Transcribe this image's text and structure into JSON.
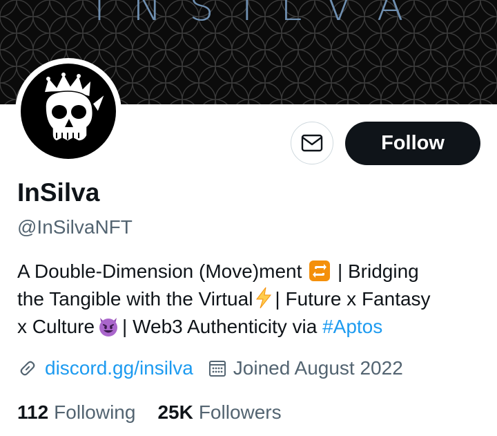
{
  "banner": {
    "title": "INSILVA"
  },
  "profile": {
    "display_name": "InSilva",
    "handle": "@InSilvaNFT"
  },
  "actions": {
    "message_icon": "envelope-icon",
    "follow_label": "Follow"
  },
  "bio": {
    "line1_pre": "A Double-Dimension (Move)ment",
    "line1_post": "| Bridging",
    "line2_pre": "the Tangible with the Virtual",
    "line2_post": "| Future x Fantasy",
    "line3_pre": "x Culture",
    "line3_post": "| Web3 Authenticity via",
    "hashtag": "#Aptos",
    "emojis": [
      "repeat-emoji",
      "lightning-emoji",
      "smiling-devil-emoji"
    ]
  },
  "meta": {
    "link_icon": "link-icon",
    "website": "discord.gg/insilva",
    "calendar_icon": "calendar-icon",
    "joined": "Joined August 2022"
  },
  "stats": {
    "following_count": "112",
    "following_label": "Following",
    "followers_count": "25K",
    "followers_label": "Followers"
  },
  "colors": {
    "accent": "#1d9bf0",
    "text_primary": "#0f1419",
    "text_secondary": "#536471",
    "follow_bg": "#0f1419",
    "banner_bg": "#0b0b0b"
  }
}
